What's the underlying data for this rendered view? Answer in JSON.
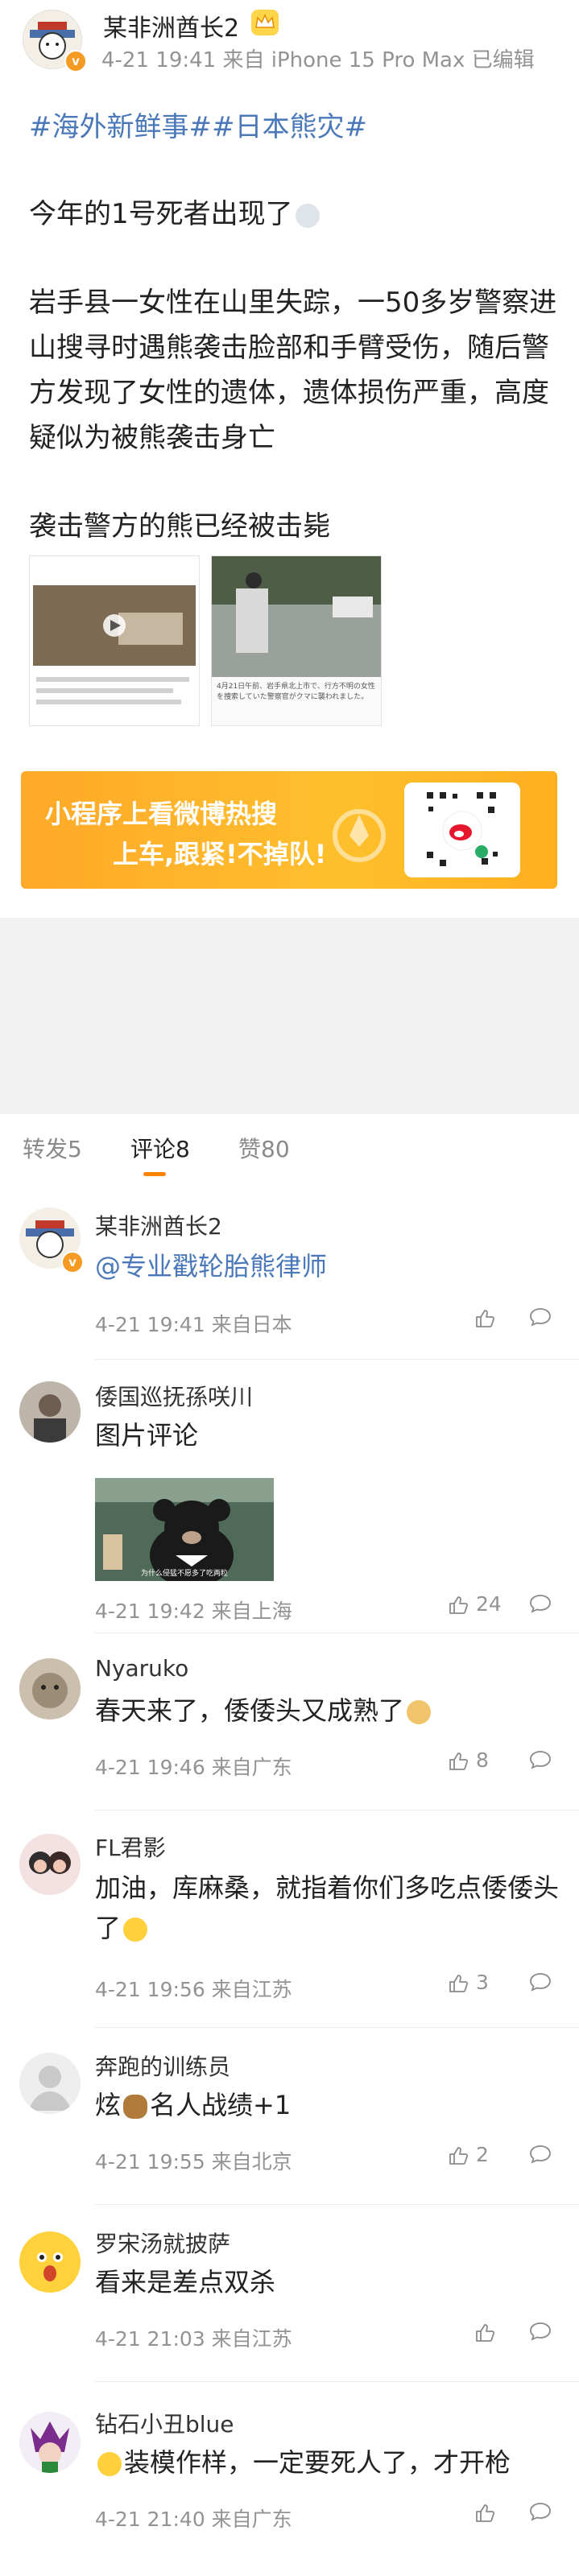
{
  "post": {
    "author": "某非洲酋长2",
    "meta": "4-21 19:41 来自 iPhone 15 Pro Max 已编辑",
    "hashtags": "#海外新鲜事##日本熊灾#",
    "paragraph1": "今年的1号死者出现了",
    "paragraph2": "岩手县一女性在山里失踪，一50多岁警察进山搜寻时遇熊袭击脸部和手臂受伤，随后警方发现了女性的遗体，遗体损伤严重，高度疑似为被熊袭击身亡",
    "paragraph3": "袭击警方的熊已经被击毙",
    "image2_caption": "4月21日午前、岩手県北上市で、行方不明の女性を捜索していた警察官がクマに襲われました。"
  },
  "banner": {
    "line1": "小程序上看微博热搜",
    "line2": "上车,跟紧!不掉队!",
    "brand_color": "#ffb123"
  },
  "tabs": {
    "repost": "转发5",
    "comment": "评论8",
    "like": "赞80",
    "accent_color": "#ff8200"
  },
  "comments": [
    {
      "name": "某非洲酋长2",
      "text": "@专业戳轮胎熊律师",
      "meta": "4-21 19:41 来自日本",
      "likes": ""
    },
    {
      "name": "倭国巡抚孫咲川",
      "text": "图片评论",
      "meta": "4-21 19:42 来自上海",
      "likes": "24"
    },
    {
      "name": "Nyaruko",
      "text": "春天来了，倭倭头又成熟了",
      "meta": "4-21 19:46 来自广东",
      "likes": "8"
    },
    {
      "name": "FL君影",
      "text": "加油，库麻桑，就指着你们多吃点倭倭头了",
      "meta": "4-21 19:56 来自江苏",
      "likes": "3"
    },
    {
      "name": "奔跑的训练员",
      "text_prefix": "炫",
      "text": "名人战绩+1",
      "meta": "4-21 19:55 来自北京",
      "likes": "2"
    },
    {
      "name": "罗宋汤就披萨",
      "text": "看来是差点双杀",
      "meta": "4-21 21:03 来自江苏",
      "likes": ""
    },
    {
      "name": "钻石小丑blue",
      "text": "装模作样，一定要死人了，才开枪",
      "meta": "4-21 21:40 来自广东",
      "likes": ""
    }
  ],
  "comment_image_caption": "为什么侵猛不愿多了吃两粒"
}
